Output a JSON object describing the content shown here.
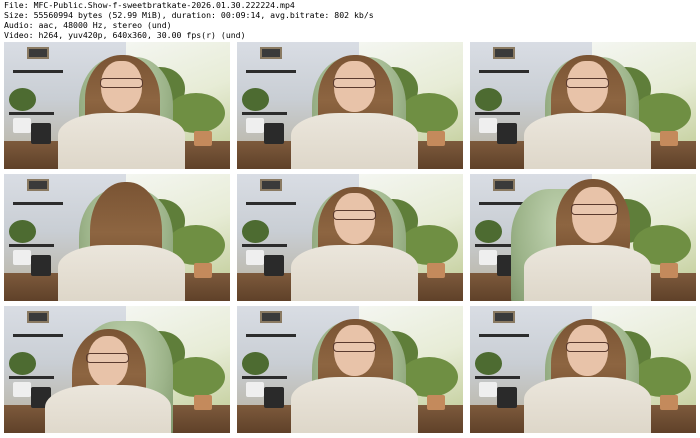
{
  "info": {
    "line1": "File: MFC-Public.Show-f-sweetbratkate-2026.01.30.222224.mp4",
    "line2": "Size: 55560994 bytes (52.99 MiB), duration: 00:09:14, avg.bitrate: 802 kb/s",
    "line3": "Audio: aac, 48000 Hz, stereo (und)",
    "line4": "Video: h264, yuv420p, 640x360, 30.00 fps(r) (und)"
  },
  "frames": [
    {
      "label": "thumbnail-1"
    },
    {
      "label": "thumbnail-2"
    },
    {
      "label": "thumbnail-3"
    },
    {
      "label": "thumbnail-4"
    },
    {
      "label": "thumbnail-5"
    },
    {
      "label": "thumbnail-6"
    },
    {
      "label": "thumbnail-7"
    },
    {
      "label": "thumbnail-8"
    },
    {
      "label": "thumbnail-9"
    }
  ],
  "colors": {
    "background": "#ffffff",
    "chair": "#9db48a",
    "sweater": "#e6e0d4",
    "floor": "#6b4a30",
    "hair": "#7f5939"
  }
}
